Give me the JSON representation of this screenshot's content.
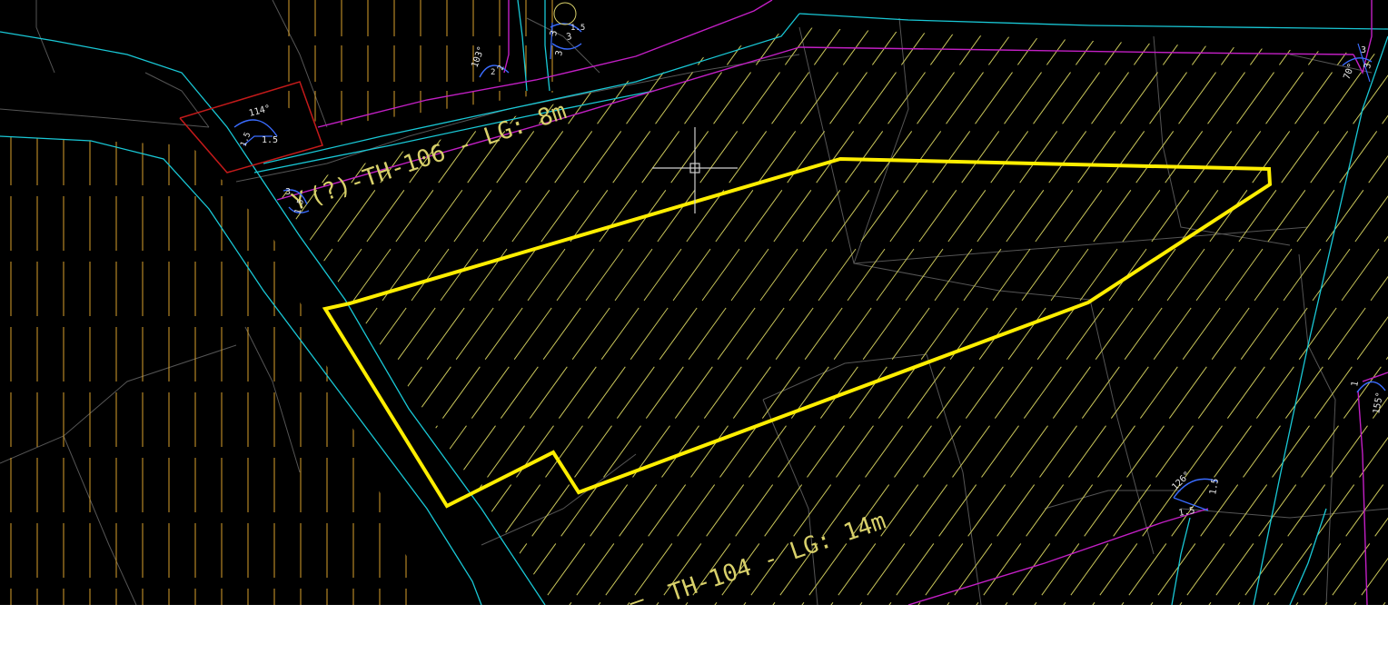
{
  "canvas": {
    "background": "#000000",
    "colors": {
      "parcel_outline": "#ffee00",
      "road_edge": "#19c8d6",
      "boundary": "#c21fc4",
      "hatch": "#c9c65a",
      "vertical_hatch": "#d8a02c",
      "thin_lines": "#555555",
      "block_outline": "#c41a1a",
      "annotation": "#e8e8e8",
      "dimension_blue": "#3a6cff",
      "crosshair": "#cfcfcf"
    }
  },
  "labels": {
    "road_top": "(?)-TH-106 - LG: 8m",
    "road_top_prefix": "Y",
    "road_bottom": "TH-104 - LG: 14m",
    "road_bottom_prefix": "—"
  },
  "dimensions": {
    "d1_angle": "114°",
    "d1_a": "1.5",
    "d1_b": "1.5",
    "d2_angle": "103°",
    "d2_a": "2",
    "d2_b": "2",
    "d3_angle": "70°",
    "d3_a": "3",
    "d4_angle": "155°",
    "d4_a": "1",
    "d5_angle": "126°",
    "d5_a": "1.5",
    "d5_b": "1.5",
    "d6_a": "3",
    "d6_b": "3",
    "d7_a": "3",
    "d7_b": "1.5",
    "d8_a": "3",
    "d8_b": "1.5"
  },
  "cursor": {
    "type": "crosshair"
  }
}
